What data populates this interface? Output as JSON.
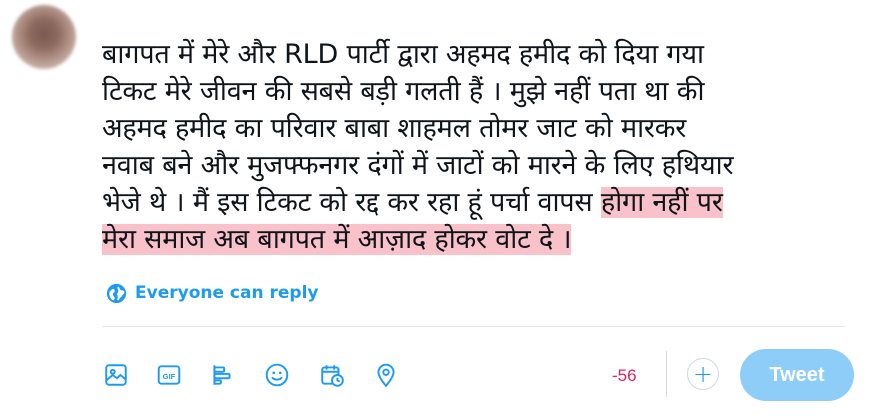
{
  "compose": {
    "lines": [
      {
        "text": "बागपत में मेरे और RLD पार्टी द्वारा अहमद हमीद को दिया गया",
        "highlight": ""
      },
      {
        "text": "टिकट मेरे जीवन की सबसे बड़ी गलती हैं । मुझे नहीं पता था की",
        "highlight": ""
      },
      {
        "text": "अहमद हमीद का परिवार बाबा शाहमल तोमर जाट को मारकर",
        "highlight": ""
      },
      {
        "text": "नवाब बने और मुजफ्फनगर दंगों में जाटों को मारने के लिए हथियार",
        "highlight": ""
      },
      {
        "text": "भेजे थे । मैं इस टिकट को रद्द कर रहा हूं पर्चा वापस ",
        "highlight": "होगा नहीं पर"
      },
      {
        "text": "",
        "highlight": "मेरा समाज अब बागपत में आज़ाद होकर वोट दे ।"
      }
    ]
  },
  "reply_setting": {
    "icon": "globe-icon",
    "label": "Everyone can reply"
  },
  "toolbar": {
    "icons": [
      "image-icon",
      "gif-icon",
      "poll-icon",
      "emoji-icon",
      "schedule-icon",
      "location-icon"
    ]
  },
  "counter": {
    "value": "-56"
  },
  "add_button": {
    "label": "+"
  },
  "tweet_button": {
    "label": "Tweet"
  },
  "colors": {
    "accent": "#1d9bf0",
    "tweet_button_disabled": "#8ecdf7",
    "highlight": "#f9c1c9",
    "over_limit": "#e0245e"
  }
}
